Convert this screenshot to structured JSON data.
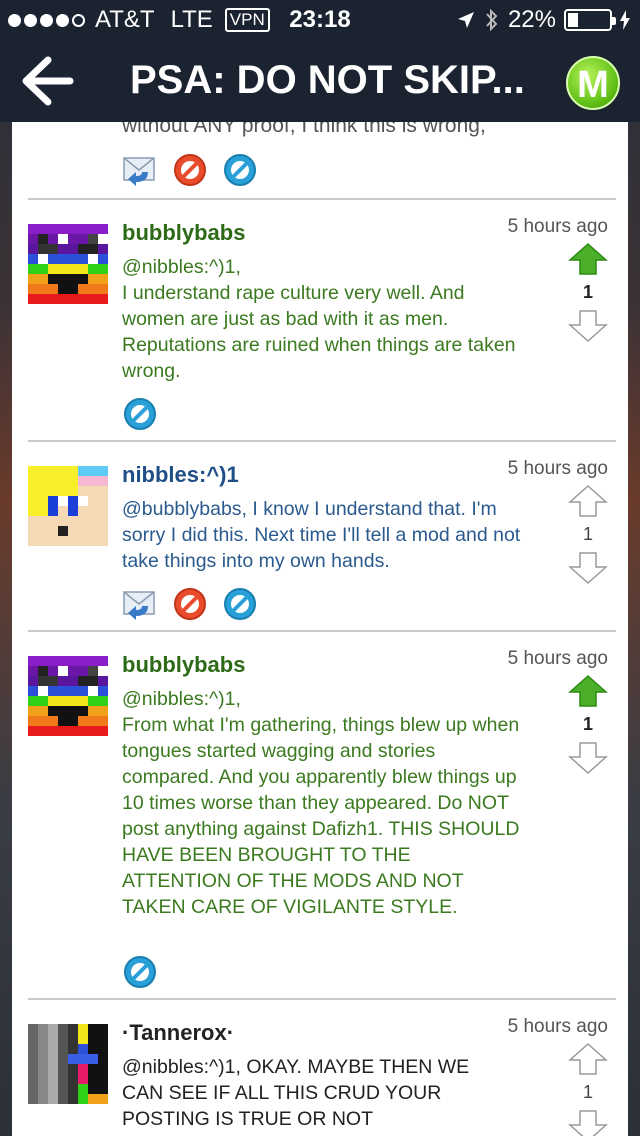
{
  "status_bar": {
    "carrier": "AT&T",
    "network": "LTE",
    "vpn": "VPN",
    "time": "23:18",
    "battery_percent_label": "22%",
    "battery_level": 0.22,
    "icons": [
      "signal-dots-icon",
      "location-arrow-icon",
      "bluetooth-icon",
      "battery-icon",
      "charging-icon"
    ]
  },
  "nav": {
    "title": "PSA: DO NOT SKIP...",
    "logo_letter": "M"
  },
  "colors": {
    "nav_bg": "#1b2230",
    "upvote_active": "#4caf2a",
    "username_green": "#2d6a16",
    "username_blue": "#1f4f86",
    "text_green": "#3b7a1f",
    "text_blue": "#2a5a8e",
    "reply_icon": "#3a7bc8",
    "block_red": "#e94c2c",
    "report_blue": "#2aa0d8"
  },
  "top_fragment": {
    "text": "without ANY proof, I think this is wrong,"
  },
  "comments": [
    {
      "username": "bubblybabs",
      "time": "5 hours ago",
      "body": "@nibbles:^)1,\nI understand rape culture very well. And women are just as bad with it as men. Reputations are ruined when things are taken wrong.",
      "score": "1",
      "upvoted": true
    },
    {
      "username": "nibbles:^)1",
      "time": "5 hours ago",
      "body": "@bubblybabs, I know I understand that. I'm sorry I did this. Next time I'll tell a mod and not take things into my own hands.",
      "score": "1",
      "upvoted": false
    },
    {
      "username": "bubblybabs",
      "time": "5 hours ago",
      "body": "@nibbles:^)1,\nFrom what I'm gathering, things blew up when tongues started wagging and stories compared. And you apparently blew things up 10 times worse than they appeared. Do NOT post anything against Dafizh1. THIS SHOULD HAVE BEEN BROUGHT TO THE ATTENTION OF THE MODS AND NOT TAKEN CARE OF VIGILANTE STYLE.",
      "score": "1",
      "upvoted": true
    },
    {
      "username": "·Tannerox·",
      "time": "5 hours ago",
      "body": "@nibbles:^)1, OKAY. MAYBE THEN WE CAN SEE IF ALL THIS CRUD YOUR POSTING IS TRUE OR NOT",
      "score": "1",
      "upvoted": false
    }
  ]
}
